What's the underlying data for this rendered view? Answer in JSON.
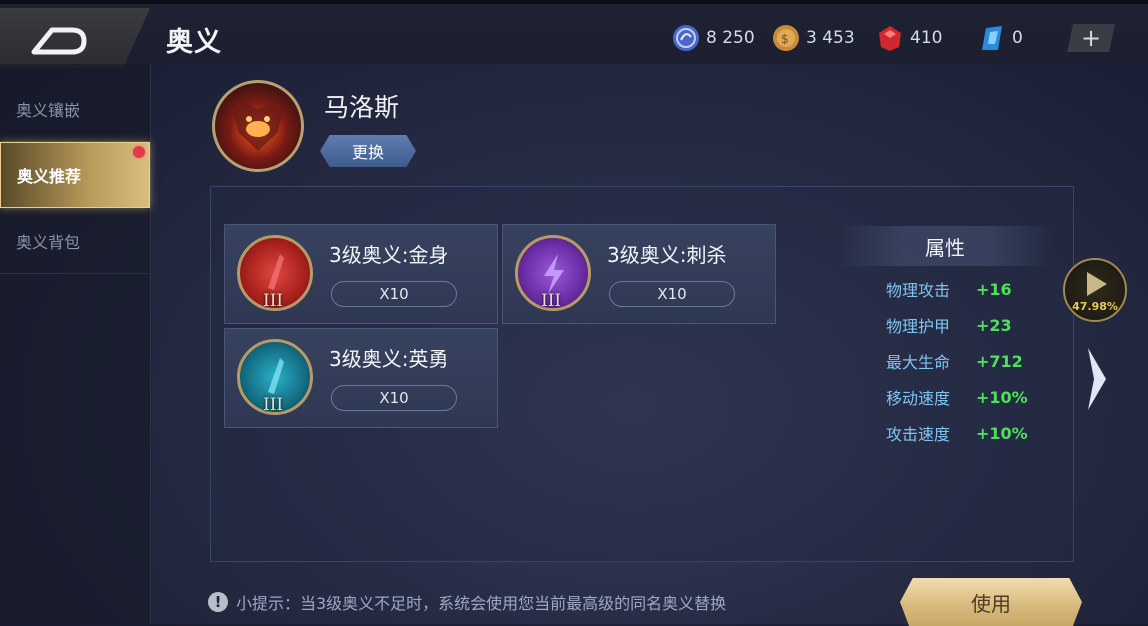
{
  "header": {
    "title": "奥义",
    "currencies": [
      {
        "name": "blue-coin",
        "value": "8 250"
      },
      {
        "name": "gold-coin",
        "value": "3 453"
      },
      {
        "name": "red-gem",
        "value": "410"
      },
      {
        "name": "blue-crystal",
        "value": "0"
      }
    ],
    "plus_label": "+"
  },
  "sidebar": {
    "items": [
      {
        "label": "奥义镶嵌",
        "active": false
      },
      {
        "label": "奥义推荐",
        "active": true
      },
      {
        "label": "奥义背包",
        "active": false
      }
    ]
  },
  "hero": {
    "name": "马洛斯",
    "change_label": "更换"
  },
  "runes": [
    {
      "name": "3级奥义:金身",
      "count": "X10",
      "level": "III",
      "color": "#c8302c"
    },
    {
      "name": "3级奥义:刺杀",
      "count": "X10",
      "level": "III",
      "color": "#7a3cb4"
    },
    {
      "name": "3级奥义:英勇",
      "count": "X10",
      "level": "III",
      "color": "#1e8ea4"
    }
  ],
  "attributes": {
    "title": "属性",
    "rows": [
      {
        "name": "物理攻击",
        "value": "+16"
      },
      {
        "name": "物理护甲",
        "value": "+23"
      },
      {
        "name": "最大生命",
        "value": "+712"
      },
      {
        "name": "移动速度",
        "value": "+10%"
      },
      {
        "name": "攻击速度",
        "value": "+10%"
      }
    ]
  },
  "win_rate": "47.98%",
  "tip": "小提示：当3级奥义不足时，系统会使用您当前最高级的同名奥义替换",
  "use_label": "使用",
  "colors": {
    "accent_gold": "#d8b97c",
    "attr_value": "#4fe05a",
    "attr_name": "#7fc4f0"
  }
}
